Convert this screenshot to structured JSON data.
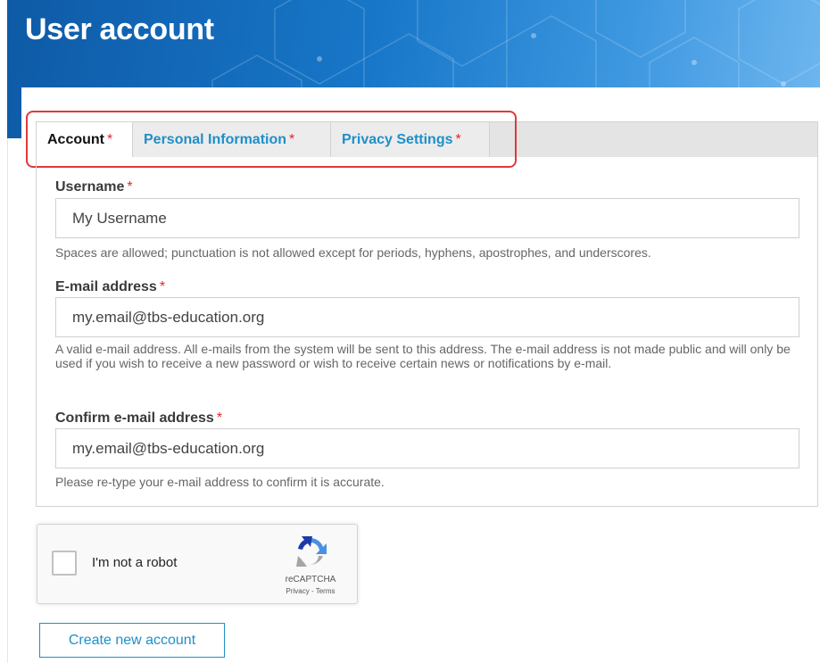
{
  "header": {
    "title": "User account"
  },
  "tabs": [
    {
      "label": "Account",
      "required_mark": "*",
      "active": true
    },
    {
      "label": "Personal Information",
      "required_mark": "*",
      "active": false
    },
    {
      "label": "Privacy Settings",
      "required_mark": "*",
      "active": false
    }
  ],
  "form": {
    "username": {
      "label": "Username",
      "required_mark": "*",
      "value": "My Username",
      "description": "Spaces are allowed; punctuation is not allowed except for periods, hyphens, apostrophes, and underscores."
    },
    "email": {
      "label": "E-mail address",
      "required_mark": "*",
      "value": "my.email@tbs-education.org",
      "description": "A valid e-mail address. All e-mails from the system will be sent to this address. The e-mail address is not made public and will only be used if you wish to receive a new password or wish to receive certain news or notifications by e-mail."
    },
    "confirm_email": {
      "label": "Confirm e-mail address",
      "required_mark": "*",
      "value": "my.email@tbs-education.org",
      "description": "Please re-type your e-mail address to confirm it is accurate."
    }
  },
  "captcha": {
    "label": "I'm not a robot",
    "brand": "reCAPTCHA",
    "links": "Privacy - Terms"
  },
  "actions": {
    "submit_label": "Create new account"
  },
  "colors": {
    "brand_blue": "#1877c9",
    "link_blue": "#1f8fc8",
    "required_red": "#e3262b",
    "highlight_red": "#e0393a"
  }
}
